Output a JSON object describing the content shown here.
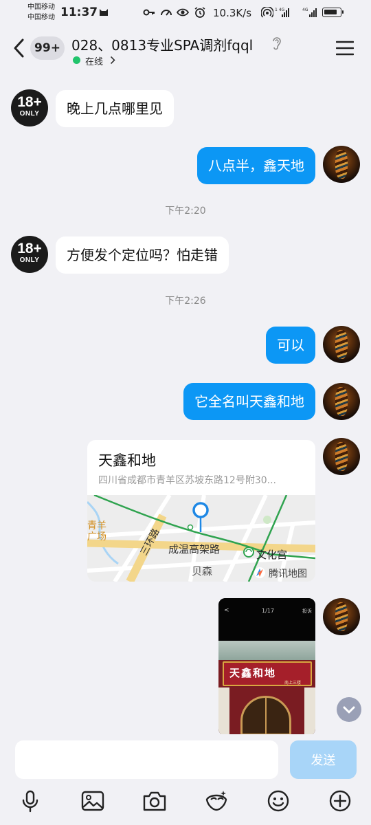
{
  "status_bar": {
    "carrier1": "中国移动",
    "carrier2": "中国移动",
    "time": "11:37",
    "net_speed": "10.3K/s",
    "icons": [
      "cat-icon",
      "key-icon",
      "speedometer-icon",
      "eye-icon",
      "alarm-icon",
      "hotspot-icon",
      "signal-icon",
      "signal-icon",
      "battery-icon"
    ]
  },
  "header": {
    "unread_badge": "99+",
    "title": "028、0813专业SPA调剂fqql",
    "status": "在线"
  },
  "messages": [
    {
      "side": "in",
      "avatar": {
        "line1": "18+",
        "line2": "ONLY"
      },
      "text": "晚上几点哪里见"
    },
    {
      "side": "out",
      "text": "八点半，鑫天地"
    },
    {
      "timestamp": "下午2:20"
    },
    {
      "side": "in",
      "avatar": {
        "line1": "18+",
        "line2": "ONLY"
      },
      "text": "方便发个定位吗？怕走错"
    },
    {
      "timestamp": "下午2:26"
    },
    {
      "side": "out",
      "text": "可以"
    },
    {
      "side": "out",
      "text": "它全名叫天鑫和地"
    }
  ],
  "location_card": {
    "name": "天鑫和地",
    "address": "四川省成都市青羊区苏坡东路12号附30...",
    "map_labels": {
      "district_a": "青羊",
      "district_b": "广场",
      "ring_road": "三环路",
      "expressway": "成温高架路",
      "station": "文化宫",
      "area": "贝森",
      "brand": "腾讯地图"
    }
  },
  "photo_card": {
    "top_page": "1/17",
    "top_right": "投诉",
    "top_back": "<",
    "sign_text": "天鑫和地",
    "sign_subtext": "南上三楼"
  },
  "input_bar": {
    "placeholder": "",
    "send_label": "发送",
    "tools": [
      "microphone-icon",
      "image-icon",
      "camera-icon",
      "sticker-icon",
      "emoji-icon",
      "plus-icon"
    ]
  },
  "colors": {
    "background": "#f1f1f5",
    "bubble_out": "#0c97f5",
    "bubble_in": "#ffffff",
    "send_disabled": "#a8d5f8",
    "online": "#21c46c"
  }
}
